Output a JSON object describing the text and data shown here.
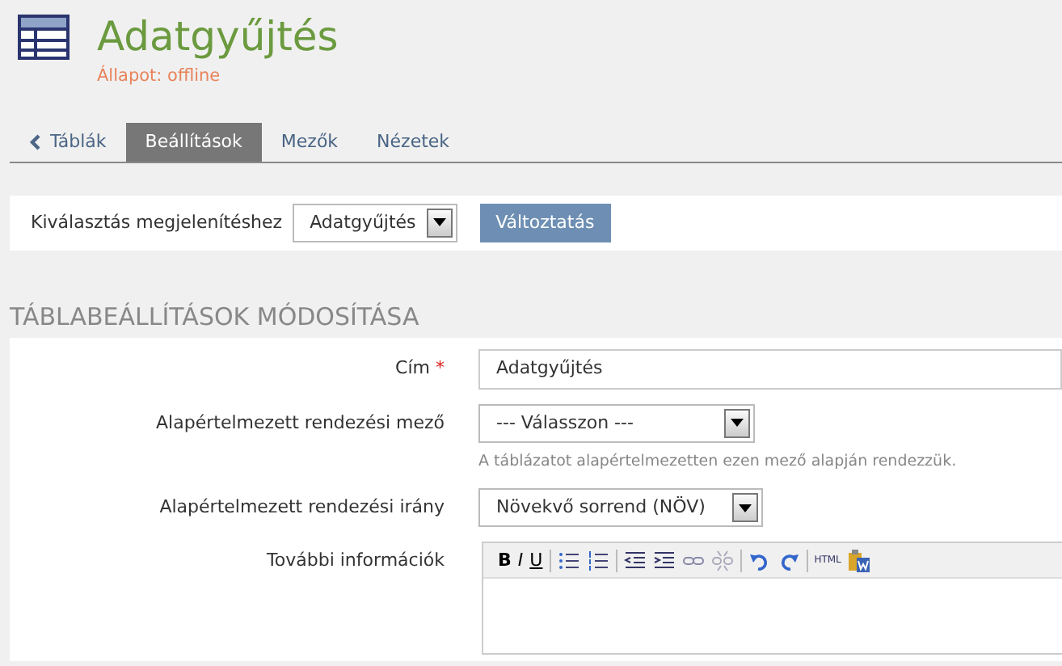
{
  "header": {
    "title": "Adatgyűjtés",
    "status": "Állapot: offline"
  },
  "tabs": [
    {
      "label": "Táblák",
      "kind": "back",
      "selected": false
    },
    {
      "label": "Beállítások",
      "kind": "tab",
      "selected": true
    },
    {
      "label": "Mezők",
      "kind": "tab",
      "selected": false
    },
    {
      "label": "Nézetek",
      "kind": "tab",
      "selected": false
    }
  ],
  "view_selector": {
    "label": "Kiválasztás megjelenítéshez",
    "value": "Adatgyűjtés",
    "button": "Változtatás"
  },
  "section_title": "TÁBLABEÁLLÍTÁSOK MÓDOSÍTÁSA",
  "fields": [
    {
      "label": "Cím",
      "required_mark": "*",
      "kind": "text",
      "value": "Adatgyűjtés"
    },
    {
      "label": "Alapértelmezett rendezési mező",
      "kind": "select",
      "value": "--- Válasszon ---",
      "help": "A táblázatot alapértelmezetten ezen mező alapján rendezzük."
    },
    {
      "label": "Alapértelmezett rendezési irány",
      "kind": "select",
      "value": "Növekvő sorrend (NÖV)"
    },
    {
      "label": "További információk",
      "kind": "editor",
      "toolbar": [
        [
          {
            "kind": "bold",
            "label": "B"
          },
          {
            "kind": "italic",
            "label": "I"
          },
          {
            "kind": "underline",
            "label": "U"
          }
        ],
        [
          {
            "kind": "bullet-list"
          },
          {
            "kind": "numbered-list"
          }
        ],
        [
          {
            "kind": "outdent"
          },
          {
            "kind": "indent"
          },
          {
            "kind": "link"
          },
          {
            "kind": "unlink"
          }
        ],
        [
          {
            "kind": "undo"
          },
          {
            "kind": "redo"
          }
        ],
        [
          {
            "kind": "html",
            "label": "HTML"
          },
          {
            "kind": "paste-word"
          }
        ]
      ]
    }
  ]
}
